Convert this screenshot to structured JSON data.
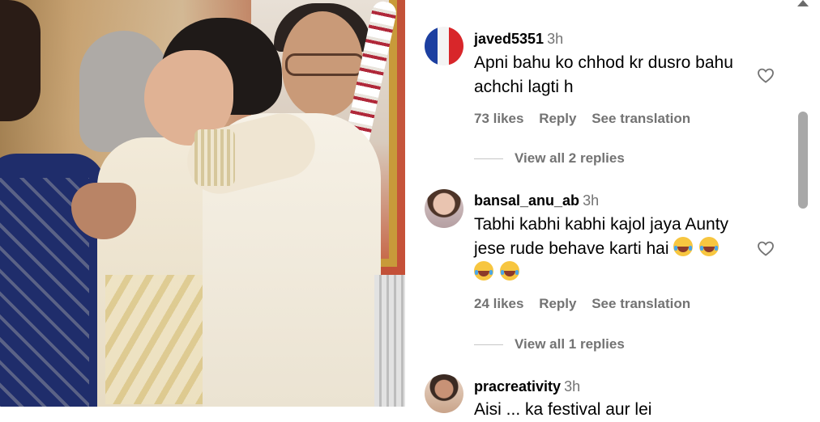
{
  "photo": {
    "label": ""
  },
  "comments": [
    {
      "username": "javed5351",
      "time": "3h",
      "text": "Apni bahu ko chhod kr dusro bahu achchi lagti h",
      "likes": "73 likes",
      "reply_label": "Reply",
      "translate_label": "See translation",
      "view_replies": "View all 2 replies",
      "avatar_icon": "flag-avatar"
    },
    {
      "username": "bansal_anu_ab",
      "time": "3h",
      "text": "Tabhi kabhi kabhi kajol jaya Aunty jese rude behave karti hai",
      "emoji_count": 4,
      "emoji_icon": "laughing-tears-emoji",
      "likes": "24 likes",
      "reply_label": "Reply",
      "translate_label": "See translation",
      "view_replies": "View all 1 replies",
      "avatar_icon": "user-avatar"
    },
    {
      "username": "pracreativity",
      "time": "3h",
      "text": "Aisi ... ka festival aur lei",
      "avatar_icon": "user-avatar"
    }
  ],
  "colors": {
    "text": "#000000",
    "muted": "#737373",
    "scroll_thumb": "#a8a8a8"
  }
}
